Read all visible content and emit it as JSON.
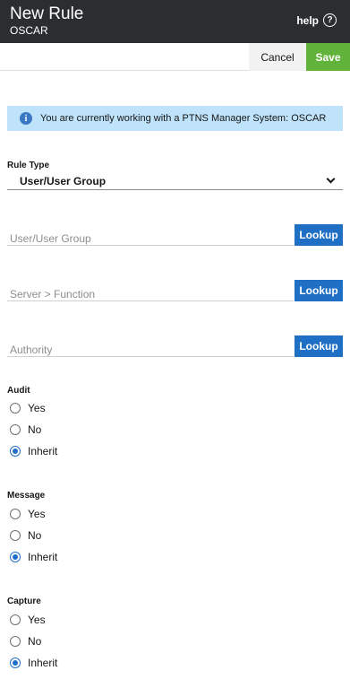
{
  "header": {
    "title": "New Rule",
    "subtitle": "OSCAR",
    "help_label": "help",
    "help_icon": "question-circle-icon"
  },
  "toolbar": {
    "cancel_label": "Cancel",
    "save_label": "Save"
  },
  "banner": {
    "icon": "info-icon",
    "text": "You are currently working with a PTNS Manager System: OSCAR"
  },
  "rule_type": {
    "label": "Rule Type",
    "selected": "User/User Group"
  },
  "lookups": [
    {
      "placeholder": "User/User Group",
      "button": "Lookup"
    },
    {
      "placeholder": "Server > Function",
      "button": "Lookup"
    },
    {
      "placeholder": "Authority",
      "button": "Lookup"
    }
  ],
  "radio_groups": [
    {
      "label": "Audit",
      "options": [
        "Yes",
        "No",
        "Inherit"
      ],
      "selected": "Inherit"
    },
    {
      "label": "Message",
      "options": [
        "Yes",
        "No",
        "Inherit"
      ],
      "selected": "Inherit"
    },
    {
      "label": "Capture",
      "options": [
        "Yes",
        "No",
        "Inherit"
      ],
      "selected": "Inherit"
    }
  ],
  "colors": {
    "header_bg": "#2b2d30",
    "save": "#62b33b",
    "lookup": "#1f6fc5",
    "banner_bg": "#bfe3fa"
  }
}
